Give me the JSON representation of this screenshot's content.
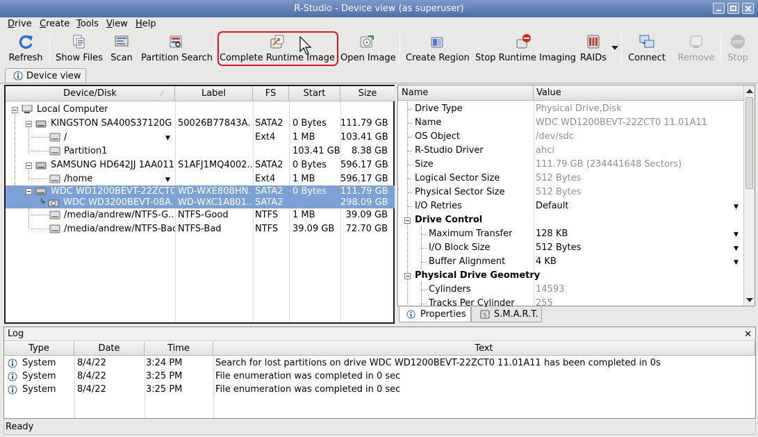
{
  "window": {
    "title": "R-Studio - Device view (as superuser)"
  },
  "menu": [
    "Drive",
    "Create",
    "Tools",
    "View",
    "Help"
  ],
  "toolbar": [
    {
      "name": "refresh",
      "label": "Refresh",
      "enabled": true
    },
    {
      "name": "show-files",
      "label": "Show Files",
      "enabled": true
    },
    {
      "name": "scan",
      "label": "Scan",
      "enabled": true
    },
    {
      "name": "partition-search",
      "label": "Partition Search",
      "enabled": true
    },
    {
      "name": "complete-runtime-image",
      "label": "Complete Runtime Image",
      "enabled": true,
      "highlighted": true
    },
    {
      "name": "open-image",
      "label": "Open Image",
      "enabled": true
    },
    {
      "name": "create-region",
      "label": "Create Region",
      "enabled": true
    },
    {
      "name": "stop-runtime-imaging",
      "label": "Stop Runtime Imaging",
      "enabled": true
    },
    {
      "name": "raids",
      "label": "RAIDs",
      "enabled": true
    },
    {
      "name": "connect",
      "label": "Connect",
      "enabled": true
    },
    {
      "name": "remove",
      "label": "Remove",
      "enabled": false
    },
    {
      "name": "stop",
      "label": "Stop",
      "enabled": false
    }
  ],
  "device_tab": {
    "label": "Device view"
  },
  "device_table": {
    "columns": [
      "Device/Disk",
      "Label",
      "FS",
      "Start",
      "Size"
    ],
    "rows": [
      {
        "name": "Local Computer",
        "label": "",
        "fs": "",
        "start": "",
        "size": "",
        "level": 0,
        "icon": "computer-icon"
      },
      {
        "name": "KINGSTON SA400S37120G ...",
        "label": "50026B77843A...",
        "fs": "SATA2",
        "start": "0 Bytes",
        "size": "111.79 GB",
        "level": 1,
        "icon": "drive-icon"
      },
      {
        "name": "/",
        "label": "",
        "fs": "Ext4",
        "start": "1 MB",
        "size": "103.41 GB",
        "level": 2,
        "icon": "partition-icon",
        "dropdown": true
      },
      {
        "name": "Partition1",
        "label": "",
        "fs": "",
        "start": "103.41 GB",
        "size": "8.38 GB",
        "level": 2,
        "icon": "partition-icon"
      },
      {
        "name": "SAMSUNG HD642JJ 1AA011...",
        "label": "S1AFJ1MQ4002...",
        "fs": "SATA2",
        "start": "0 Bytes",
        "size": "596.17 GB",
        "level": 1,
        "icon": "drive-icon"
      },
      {
        "name": "/home",
        "label": "",
        "fs": "Ext4",
        "start": "1 MB",
        "size": "596.17 GB",
        "level": 2,
        "icon": "partition-icon",
        "dropdown": true
      },
      {
        "name": "WDC WD1200BEVT-22ZCT0...",
        "label": "WD-WXE808HN...",
        "fs": "SATA2",
        "start": "0 Bytes",
        "size": "111.79 GB",
        "level": 1,
        "icon": "drive-icon",
        "selected": true
      },
      {
        "name": "WDC WD3200BEVT-08A...",
        "label": "WD-WXC1A801...",
        "fs": "SATA2",
        "start": "",
        "size": "298.09 GB",
        "level": 2,
        "icon": "image-drive-icon",
        "selected": true
      },
      {
        "name": "/media/andrew/NTFS-G...",
        "label": "NTFS-Good",
        "fs": "NTFS",
        "start": "1 MB",
        "size": "39.09 GB",
        "level": 2,
        "icon": "partition-icon"
      },
      {
        "name": "/media/andrew/NTFS-Bad",
        "label": "NTFS-Bad",
        "fs": "NTFS",
        "start": "39.09 GB",
        "size": "72.70 GB",
        "level": 2,
        "icon": "partition-icon"
      }
    ]
  },
  "properties": {
    "columns": [
      "Name",
      "Value"
    ],
    "rows": [
      {
        "name": "Drive Type",
        "value": "Physical Drive,Disk",
        "indent": 1,
        "gray": true
      },
      {
        "name": "Name",
        "value": "WDC WD1200BEVT-22ZCT0 11.01A11",
        "indent": 1,
        "gray": true
      },
      {
        "name": "OS Object",
        "value": "/dev/sdc",
        "indent": 1,
        "gray": true
      },
      {
        "name": "R-Studio Driver",
        "value": "ahci",
        "indent": 1,
        "gray": true
      },
      {
        "name": "Size",
        "value": "111.79 GB (234441648 Sectors)",
        "indent": 1,
        "gray": true
      },
      {
        "name": "Logical Sector Size",
        "value": "512 Bytes",
        "indent": 1,
        "gray": true
      },
      {
        "name": "Physical Sector Size",
        "value": "512 Bytes",
        "indent": 1,
        "gray": true
      },
      {
        "name": "I/O Retries",
        "value": "Default",
        "indent": 1,
        "dropdown": true
      },
      {
        "name": "Drive Control",
        "value": "",
        "section": true
      },
      {
        "name": "Maximum Transfer",
        "value": "128 KB",
        "indent": 2,
        "dropdown": true
      },
      {
        "name": "I/O Block Size",
        "value": "512 Bytes",
        "indent": 2,
        "dropdown": true
      },
      {
        "name": "Buffer Alignment",
        "value": "4 KB",
        "indent": 2,
        "dropdown": true
      },
      {
        "name": "Physical Drive Geometry",
        "value": "",
        "section": true
      },
      {
        "name": "Cylinders",
        "value": "14593",
        "indent": 2,
        "gray": true
      },
      {
        "name": "Tracks Per Cylinder",
        "value": "255",
        "indent": 2,
        "gray": true
      }
    ],
    "tabs": [
      "Properties",
      "S.M.A.R.T."
    ]
  },
  "log": {
    "title": "Log",
    "columns": [
      "Type",
      "Date",
      "Time",
      "Text"
    ],
    "rows": [
      {
        "type": "System",
        "date": "8/4/22",
        "time": "3:24 PM",
        "text": "Search for lost partitions on drive WDC WD1200BEVT-22ZCT0 11.01A11 has been completed in 0s"
      },
      {
        "type": "System",
        "date": "8/4/22",
        "time": "3:25 PM",
        "text": "File enumeration was completed in 0 sec"
      },
      {
        "type": "System",
        "date": "8/4/22",
        "time": "3:25 PM",
        "text": "File enumeration was completed in 0 sec"
      }
    ]
  },
  "status": {
    "text": "Ready"
  }
}
